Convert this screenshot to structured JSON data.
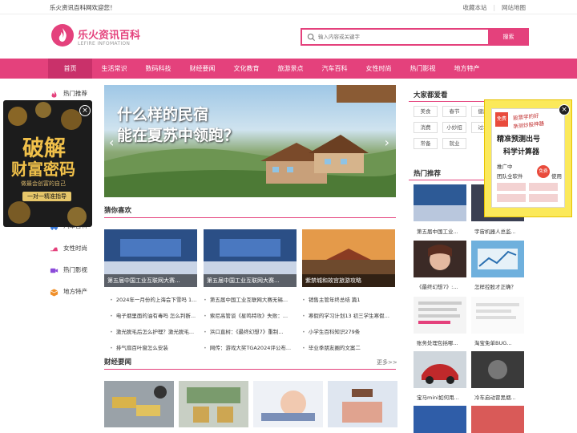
{
  "topbar": {
    "welcome": "乐火资讯百科网欢迎您！",
    "favorite": "收藏本站",
    "sitemap": "网站地图"
  },
  "logo": {
    "name": "乐火资讯百科",
    "sub": "LEFIRE INFOMATION"
  },
  "search": {
    "placeholder": "输入内容或关键字",
    "button": "搜索"
  },
  "nav": [
    "首页",
    "生活常识",
    "数码科技",
    "财经要闻",
    "文化教育",
    "旅游景点",
    "汽车百科",
    "女性时尚",
    "热门影视",
    "地方特产"
  ],
  "left_side": {
    "items": [
      "热门推荐",
      "汽车百科",
      "女性时尚",
      "热门影视",
      "地方特产"
    ],
    "hidden_partial": "汽车百科"
  },
  "ad_left": {
    "line1": "破解",
    "line2": "财富密码",
    "line3": "做最会创富的自己",
    "line4": "一对一精准指导"
  },
  "banner": {
    "line1": "什么样的民宿",
    "line2": "能在夏苏中领跑？"
  },
  "guess": {
    "title": "猜你喜欢",
    "cards": [
      "第五届中国工业互联网大赛...",
      "第五届中国工业互联网大赛...",
      "紫禁城和故宫旅游攻略"
    ],
    "col1": [
      "2024年一月份的上海会下雪吗 1...",
      "电子烟里面的油有毒吗 怎么判断...",
      "激光脱毛后怎么护理？激光脱毛...",
      "排气扇百叶窗怎么安装"
    ],
    "col2": [
      "第五届中国工业互联网大赛无锡...",
      "索尼高管谈《星鸣特攻》失败：...",
      "浜口直树：《最终幻想7》重制...",
      "网传：游戏大奖TGA2024评公布..."
    ],
    "col3": [
      "销售主管年终总结 篇1",
      "寒假的学习计划13 初三学生寒假...",
      "小学生百科知识279条",
      "毕业季朋友圈的文案二"
    ]
  },
  "finance": {
    "title": "财经要闻",
    "more": "更多>>"
  },
  "right": {
    "popular_title": "大家都爱看",
    "tags": [
      "美食",
      "春节",
      "健康",
      "消费",
      "小妙招",
      "过年",
      "常备",
      "就业"
    ],
    "hot_title": "热门推荐",
    "thumbs": [
      "第五届中国工业...",
      "宇宙机器人总监...",
      "《最终幻想7》:...",
      "怎样控股才正确？",
      "账务处理包括哪...",
      "淘宝免单BUG...",
      "宝马mini如何用...",
      "冷车启动冒黑烟..."
    ]
  },
  "ad_right": {
    "badge": "免费",
    "line1": "股票学的好",
    "line2": "亲测炒股神器",
    "line3": "精准预测出号",
    "line4": "科学计算器",
    "line5": "推广中",
    "line6": "团队全软件",
    "stamp": "免费",
    "line7": "使用"
  },
  "colors": {
    "accent": "#e4417c",
    "nav_active": "#c9316a"
  }
}
